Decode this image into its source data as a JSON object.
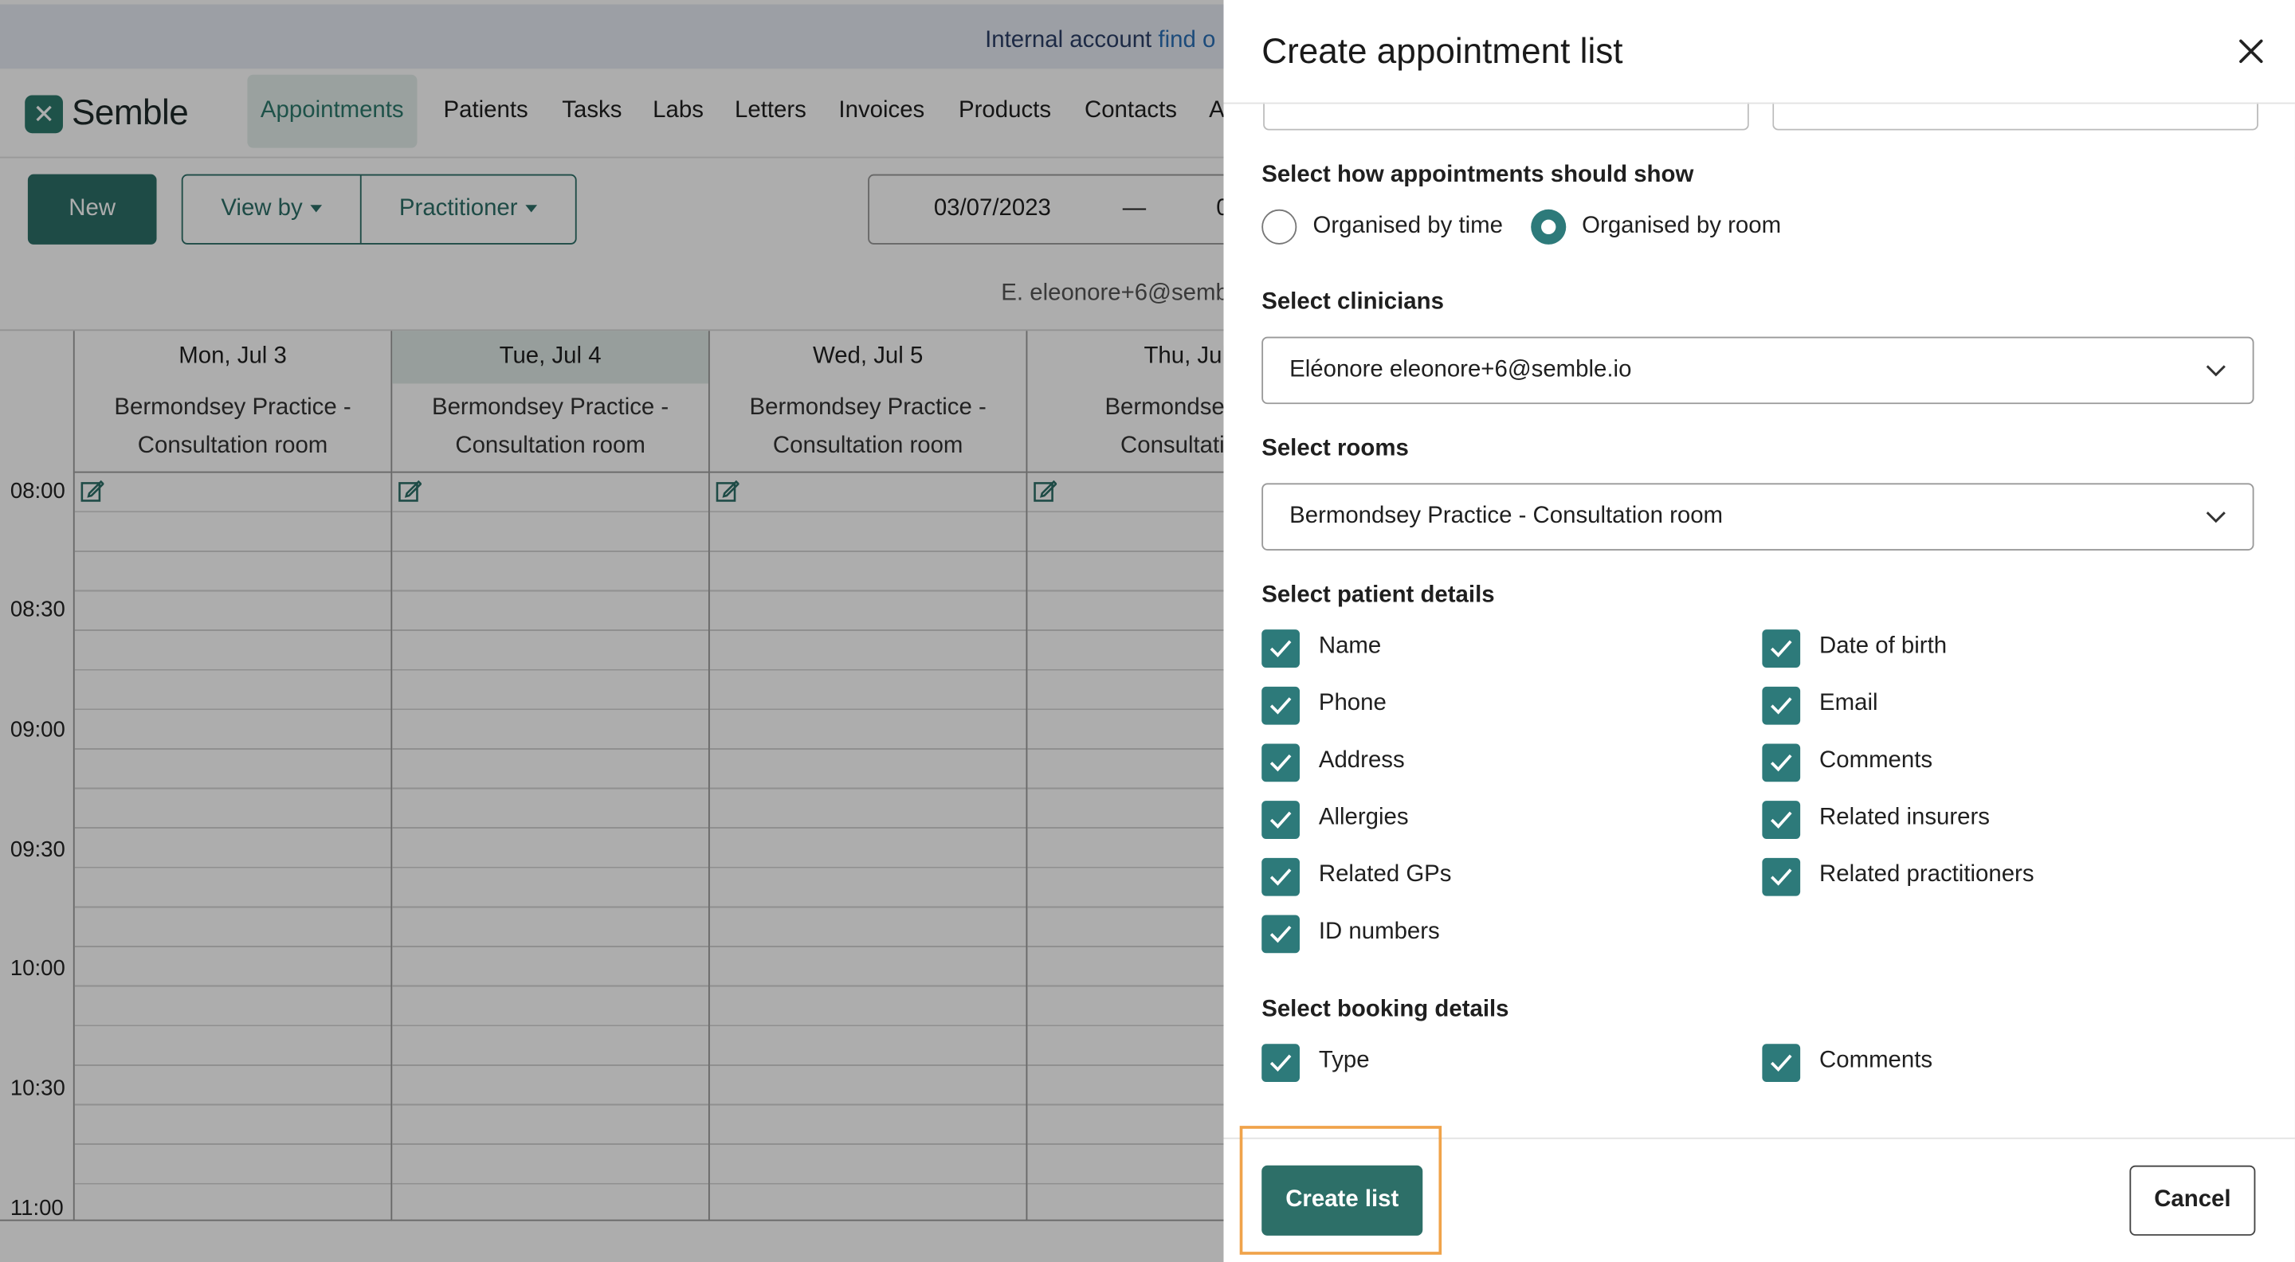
{
  "banner": {
    "text": "Internal account",
    "link": "find o"
  },
  "brand": {
    "name": "Semble",
    "mark": "✕"
  },
  "nav": [
    {
      "label": "Appointments",
      "active": true
    },
    {
      "label": "Patients"
    },
    {
      "label": "Tasks"
    },
    {
      "label": "Labs"
    },
    {
      "label": "Letters"
    },
    {
      "label": "Invoices"
    },
    {
      "label": "Products"
    },
    {
      "label": "Contacts"
    },
    {
      "label": "A"
    }
  ],
  "toolbar": {
    "new_label": "New",
    "view_by_label": "View by",
    "practitioner_label": "Practitioner",
    "date_start": "03/07/2023",
    "date_sep": "—",
    "date_end_partial": "0",
    "user": "E. eleonore+6@semb"
  },
  "calendar": {
    "days": [
      {
        "label": "Mon, Jul 3",
        "room_line1": "Bermondsey Practice -",
        "room_line2": "Consultation room"
      },
      {
        "label": "Tue, Jul 4",
        "room_line1": "Bermondsey Practice -",
        "room_line2": "Consultation room",
        "today": true
      },
      {
        "label": "Wed, Jul 5",
        "room_line1": "Bermondsey Practice -",
        "room_line2": "Consultation room"
      },
      {
        "label": "Thu, Jul",
        "room_line1": "Bermondsey Pr",
        "room_line2": "Consultation"
      }
    ],
    "times": [
      "08:00",
      "08:30",
      "09:00",
      "09:30",
      "10:00",
      "10:30",
      "11:00"
    ]
  },
  "modal": {
    "title": "Create appointment list",
    "show_section": "Select how appointments should show",
    "radio_time": "Organised by time",
    "radio_room": "Organised by room",
    "selected_option": "room",
    "clinicians_section": "Select clinicians",
    "clinicians_value": "Eléonore eleonore+6@semble.io",
    "rooms_section": "Select rooms",
    "rooms_value": "Bermondsey Practice - Consultation room",
    "patient_section": "Select patient details",
    "patient_left": [
      "Name",
      "Phone",
      "Address",
      "Allergies",
      "Related GPs",
      "ID numbers"
    ],
    "patient_right": [
      "Date of birth",
      "Email",
      "Comments",
      "Related insurers",
      "Related practitioners"
    ],
    "booking_section": "Select booking details",
    "booking_left": [
      "Type"
    ],
    "booking_right": [
      "Comments"
    ],
    "create_label": "Create list",
    "cancel_label": "Cancel"
  },
  "colors": {
    "accent": "#2d7a7a",
    "primary_button": "#2d6f68",
    "highlight": "#f0a34a"
  }
}
